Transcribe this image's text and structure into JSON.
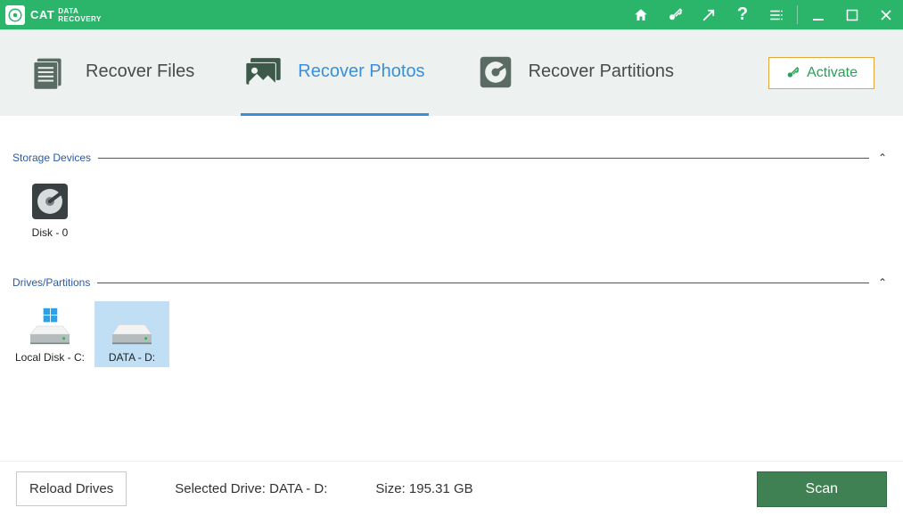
{
  "app": {
    "brand": "CAT",
    "brand_sub1": "DATA",
    "brand_sub2": "RECOVERY"
  },
  "titlebar_icons": {
    "home": "home-icon",
    "key": "key-icon",
    "share": "share-icon",
    "help": "help-icon",
    "menu": "menu-icon",
    "min": "minimize-icon",
    "max": "maximize-icon",
    "close": "close-icon"
  },
  "tabs": [
    {
      "label": "Recover Files",
      "active": false
    },
    {
      "label": "Recover Photos",
      "active": true
    },
    {
      "label": "Recover Partitions",
      "active": false
    }
  ],
  "activate": {
    "label": "Activate"
  },
  "sections": {
    "storage": {
      "title": "Storage Devices",
      "items": [
        {
          "label": "Disk - 0",
          "type": "disk"
        }
      ]
    },
    "partitions": {
      "title": "Drives/Partitions",
      "items": [
        {
          "label": "Local Disk - C:",
          "type": "drive",
          "os": "windows",
          "selected": false
        },
        {
          "label": "DATA - D:",
          "type": "drive",
          "os": "none",
          "selected": true
        }
      ]
    }
  },
  "footer": {
    "reload": "Reload Drives",
    "selected_drive_label": "Selected Drive: ",
    "selected_drive_value": "DATA - D:",
    "size_label": "Size: ",
    "size_value": "195.31 GB",
    "scan": "Scan"
  }
}
